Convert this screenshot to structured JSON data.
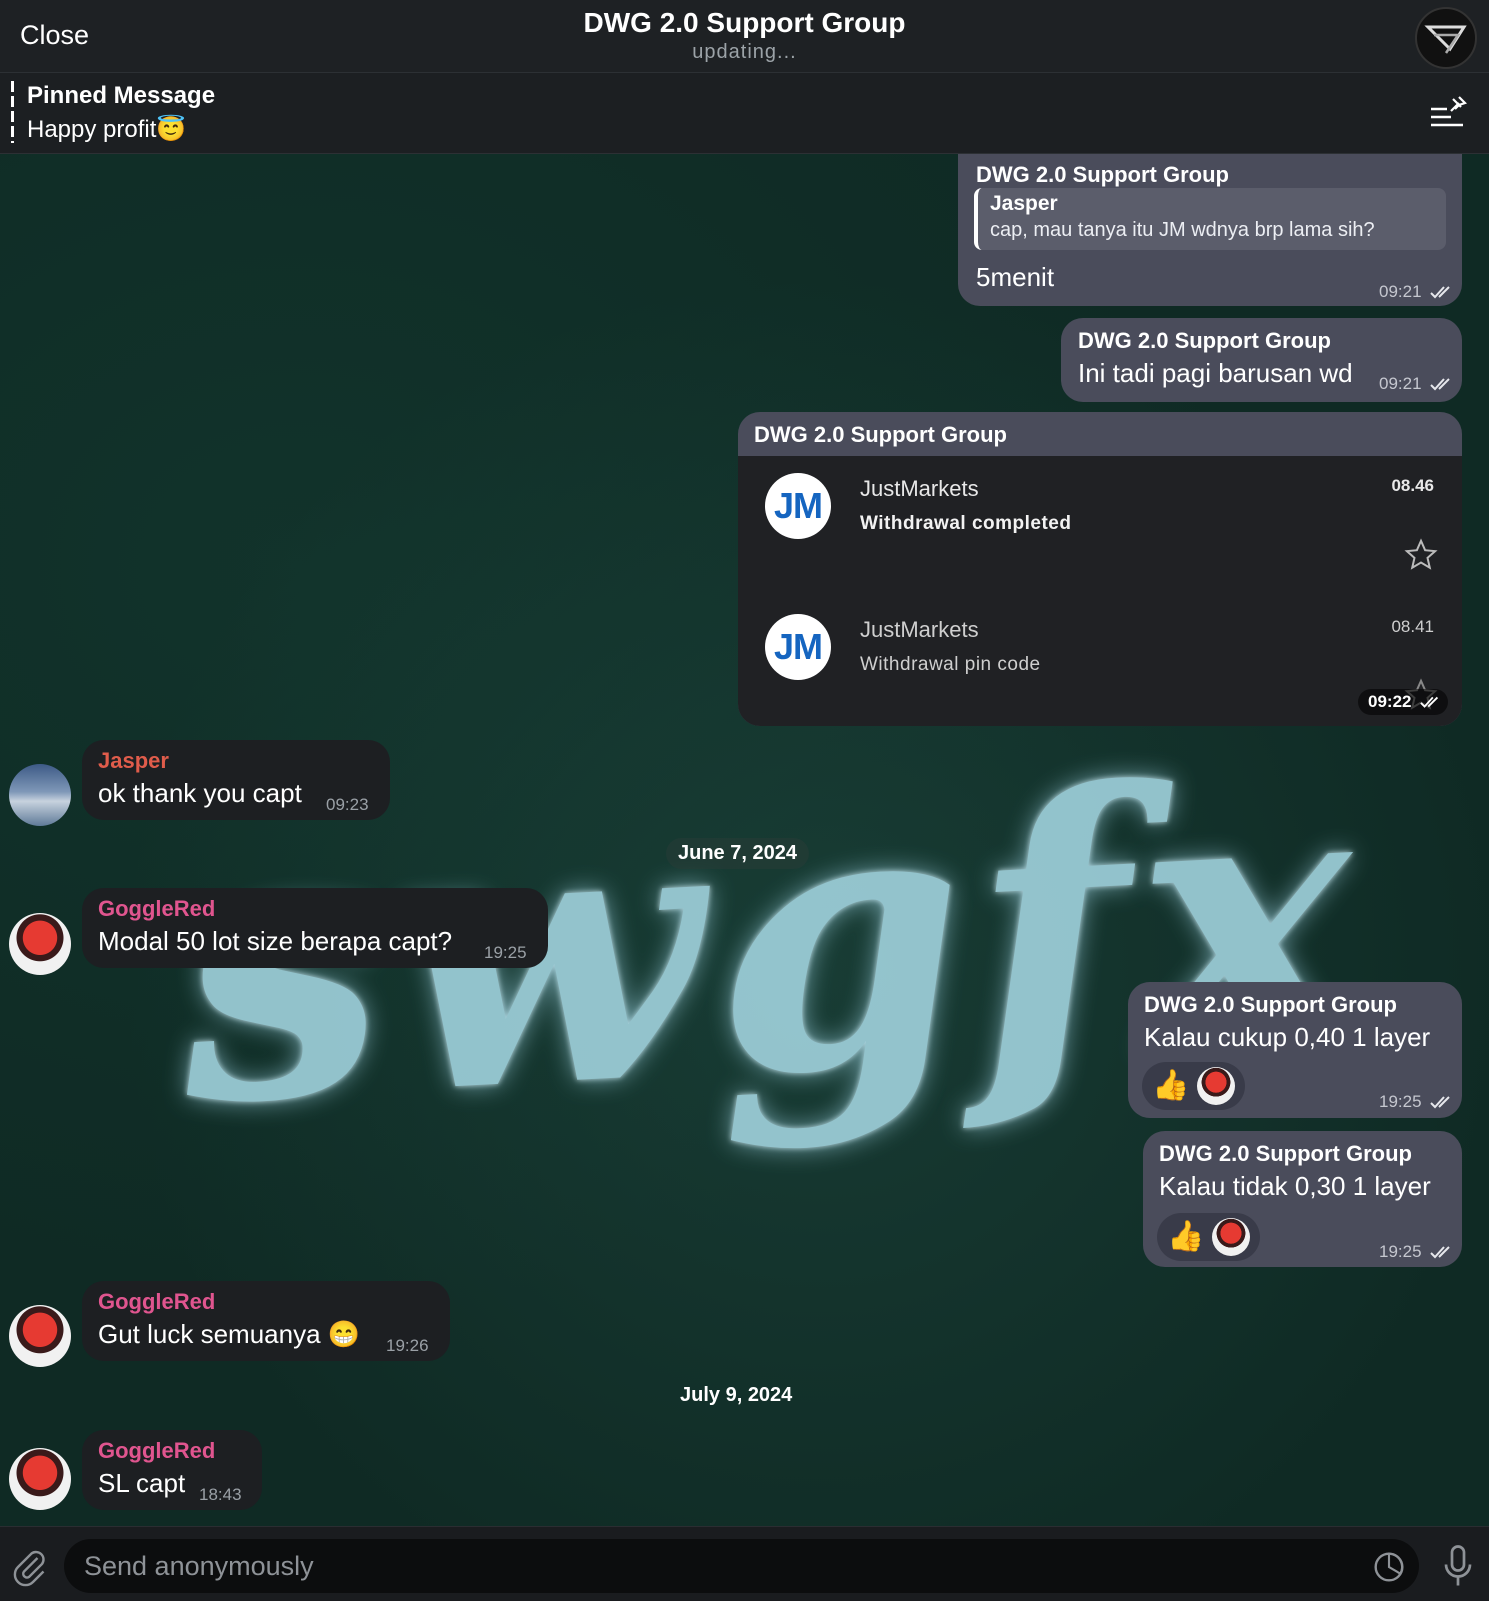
{
  "header": {
    "close_label": "Close",
    "title": "DWG 2.0 Support Group",
    "subtitle": "updating..."
  },
  "pinned": {
    "title": "Pinned Message",
    "text": "Happy profit😇"
  },
  "background_art_text": "swgfx",
  "messages": {
    "m1": {
      "sender": "DWG 2.0 Support Group",
      "reply_name": "Jasper",
      "reply_text": "cap, mau tanya itu JM wdnya brp lama sih?",
      "text": "5menit",
      "time": "09:21"
    },
    "m2": {
      "sender": "DWG 2.0 Support Group",
      "text": "Ini tadi pagi barusan wd",
      "time": "09:21"
    },
    "m3": {
      "sender": "DWG 2.0 Support Group",
      "time": "09:22",
      "notifications": [
        {
          "logo": "JM",
          "app": "JustMarkets",
          "time": "08.46",
          "text": "Withdrawal completed"
        },
        {
          "logo": "JM",
          "app": "JustMarkets",
          "time": "08.41",
          "text": "Withdrawal pin code"
        }
      ]
    },
    "m4": {
      "sender": "Jasper",
      "text": "ok thank you capt",
      "time": "09:23"
    },
    "date1": "June 7, 2024",
    "m5": {
      "sender": "GoggleRed",
      "text": "Modal 50 lot size berapa capt?",
      "time": "19:25"
    },
    "m6": {
      "sender": "DWG 2.0 Support Group",
      "text": "Kalau cukup 0,40 1 layer",
      "reaction": "👍",
      "time": "19:25"
    },
    "m7": {
      "sender": "DWG 2.0 Support Group",
      "text": "Kalau tidak 0,30 1 layer",
      "reaction": "👍",
      "time": "19:25"
    },
    "m8": {
      "sender": "GoggleRed",
      "text": "Gut luck semuanya 😁",
      "time": "19:26"
    },
    "date2": "July 9, 2024",
    "m9": {
      "sender": "GoggleRed",
      "text": "SL capt",
      "time": "18:43"
    }
  },
  "input": {
    "placeholder": "Send anonymously"
  },
  "colors": {
    "outgoing_bubble": "#4a4c5b",
    "incoming_bubble": "#1d1f22",
    "jasper_name": "#e05c4b",
    "gogglered_name": "#e0558f"
  }
}
